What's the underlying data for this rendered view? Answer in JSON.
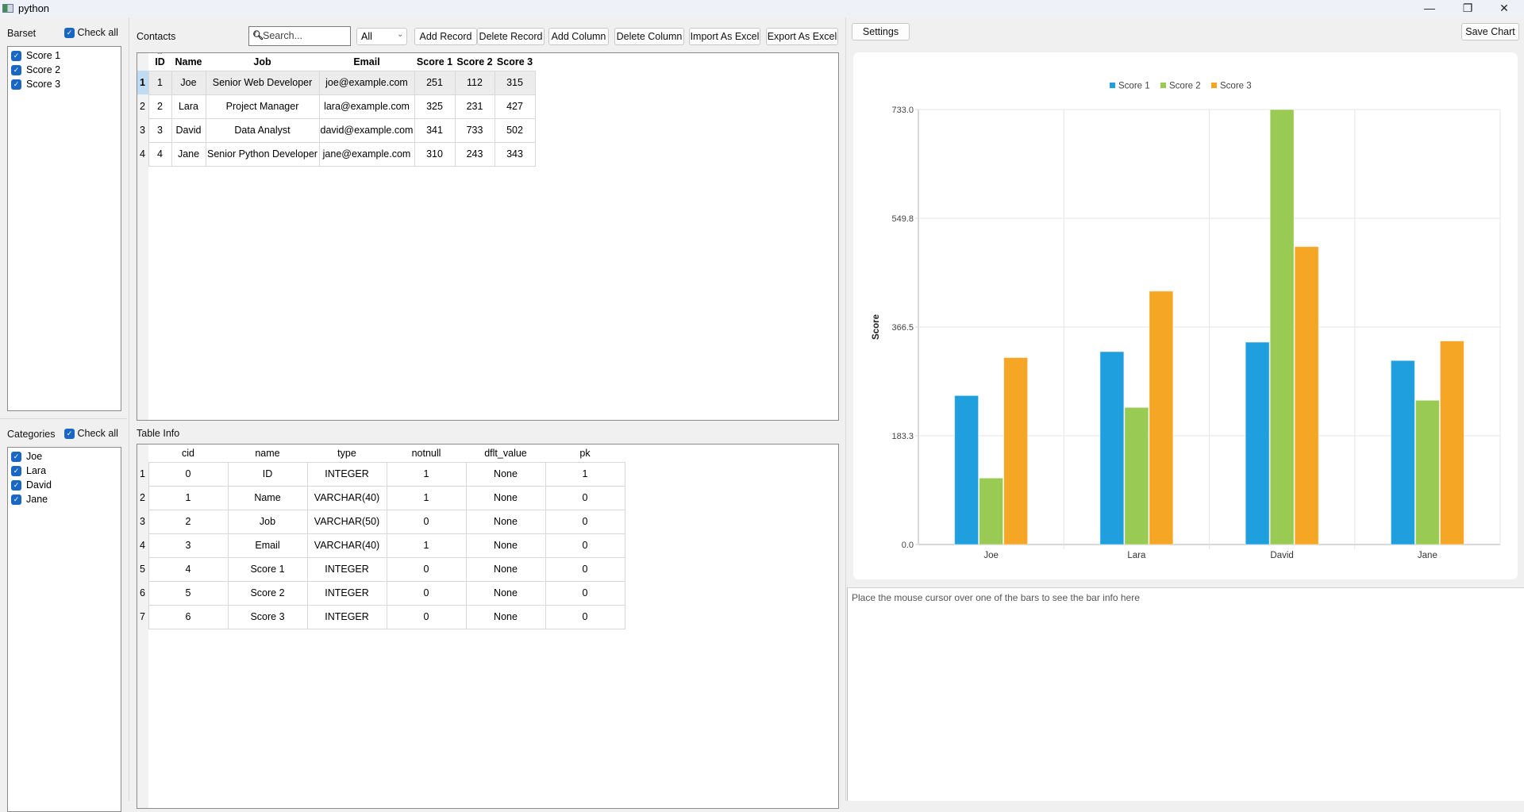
{
  "window": {
    "title": "python",
    "minimize": "—",
    "restore": "❐",
    "close": "✕"
  },
  "barset": {
    "label": "Barset",
    "check_all": "Check all",
    "items": [
      "Score 1",
      "Score 2",
      "Score 3"
    ]
  },
  "categories": {
    "label": "Categories",
    "check_all": "Check all",
    "items": [
      "Joe",
      "Lara",
      "David",
      "Jane"
    ]
  },
  "contacts": {
    "label": "Contacts",
    "search_placeholder": "Search...",
    "filter_value": "All",
    "buttons": [
      "Add Record",
      "Delete Record",
      "Add Column",
      "Delete Column",
      "Import As Excel",
      "Export As Excel"
    ],
    "columns": [
      "ID",
      "Name",
      "Job",
      "Email",
      "Score 1",
      "Score 2",
      "Score 3"
    ],
    "sorted_column": "ID",
    "rows": [
      [
        "1",
        "Joe",
        "Senior Web Developer",
        "joe@example.com",
        "251",
        "112",
        "315"
      ],
      [
        "2",
        "Lara",
        "Project Manager",
        "lara@example.com",
        "325",
        "231",
        "427"
      ],
      [
        "3",
        "David",
        "Data Analyst",
        "david@example.com",
        "341",
        "733",
        "502"
      ],
      [
        "4",
        "Jane",
        "Senior Python Developer",
        "jane@example.com",
        "310",
        "243",
        "343"
      ]
    ],
    "selected_row": 1
  },
  "table_info": {
    "label": "Table Info",
    "columns": [
      "cid",
      "name",
      "type",
      "notnull",
      "dflt_value",
      "pk"
    ],
    "rows": [
      [
        "0",
        "ID",
        "INTEGER",
        "1",
        "None",
        "1"
      ],
      [
        "1",
        "Name",
        "VARCHAR(40)",
        "1",
        "None",
        "0"
      ],
      [
        "2",
        "Job",
        "VARCHAR(50)",
        "0",
        "None",
        "0"
      ],
      [
        "3",
        "Email",
        "VARCHAR(40)",
        "1",
        "None",
        "0"
      ],
      [
        "4",
        "Score 1",
        "INTEGER",
        "0",
        "None",
        "0"
      ],
      [
        "5",
        "Score 2",
        "INTEGER",
        "0",
        "None",
        "0"
      ],
      [
        "6",
        "Score 3",
        "INTEGER",
        "0",
        "None",
        "0"
      ]
    ]
  },
  "chart_panel": {
    "settings_label": "Settings",
    "save_label": "Save Chart",
    "hover_hint": "Place the mouse cursor over one of the bars to see the bar info here"
  },
  "chart_data": {
    "type": "bar",
    "title": "",
    "xlabel": "",
    "ylabel": "Score",
    "categories": [
      "Joe",
      "Lara",
      "David",
      "Jane"
    ],
    "series": [
      {
        "name": "Score 1",
        "color": "#209fdf",
        "values": [
          251,
          325,
          341,
          310
        ]
      },
      {
        "name": "Score 2",
        "color": "#99ca53",
        "values": [
          112,
          231,
          733,
          243
        ]
      },
      {
        "name": "Score 3",
        "color": "#f6a625",
        "values": [
          315,
          427,
          502,
          343
        ]
      }
    ],
    "ylim": [
      0,
      733
    ],
    "yticks": [
      "0.0",
      "183.3",
      "366.5",
      "549.8",
      "733.0"
    ],
    "grid": true,
    "legend": "top-center"
  }
}
